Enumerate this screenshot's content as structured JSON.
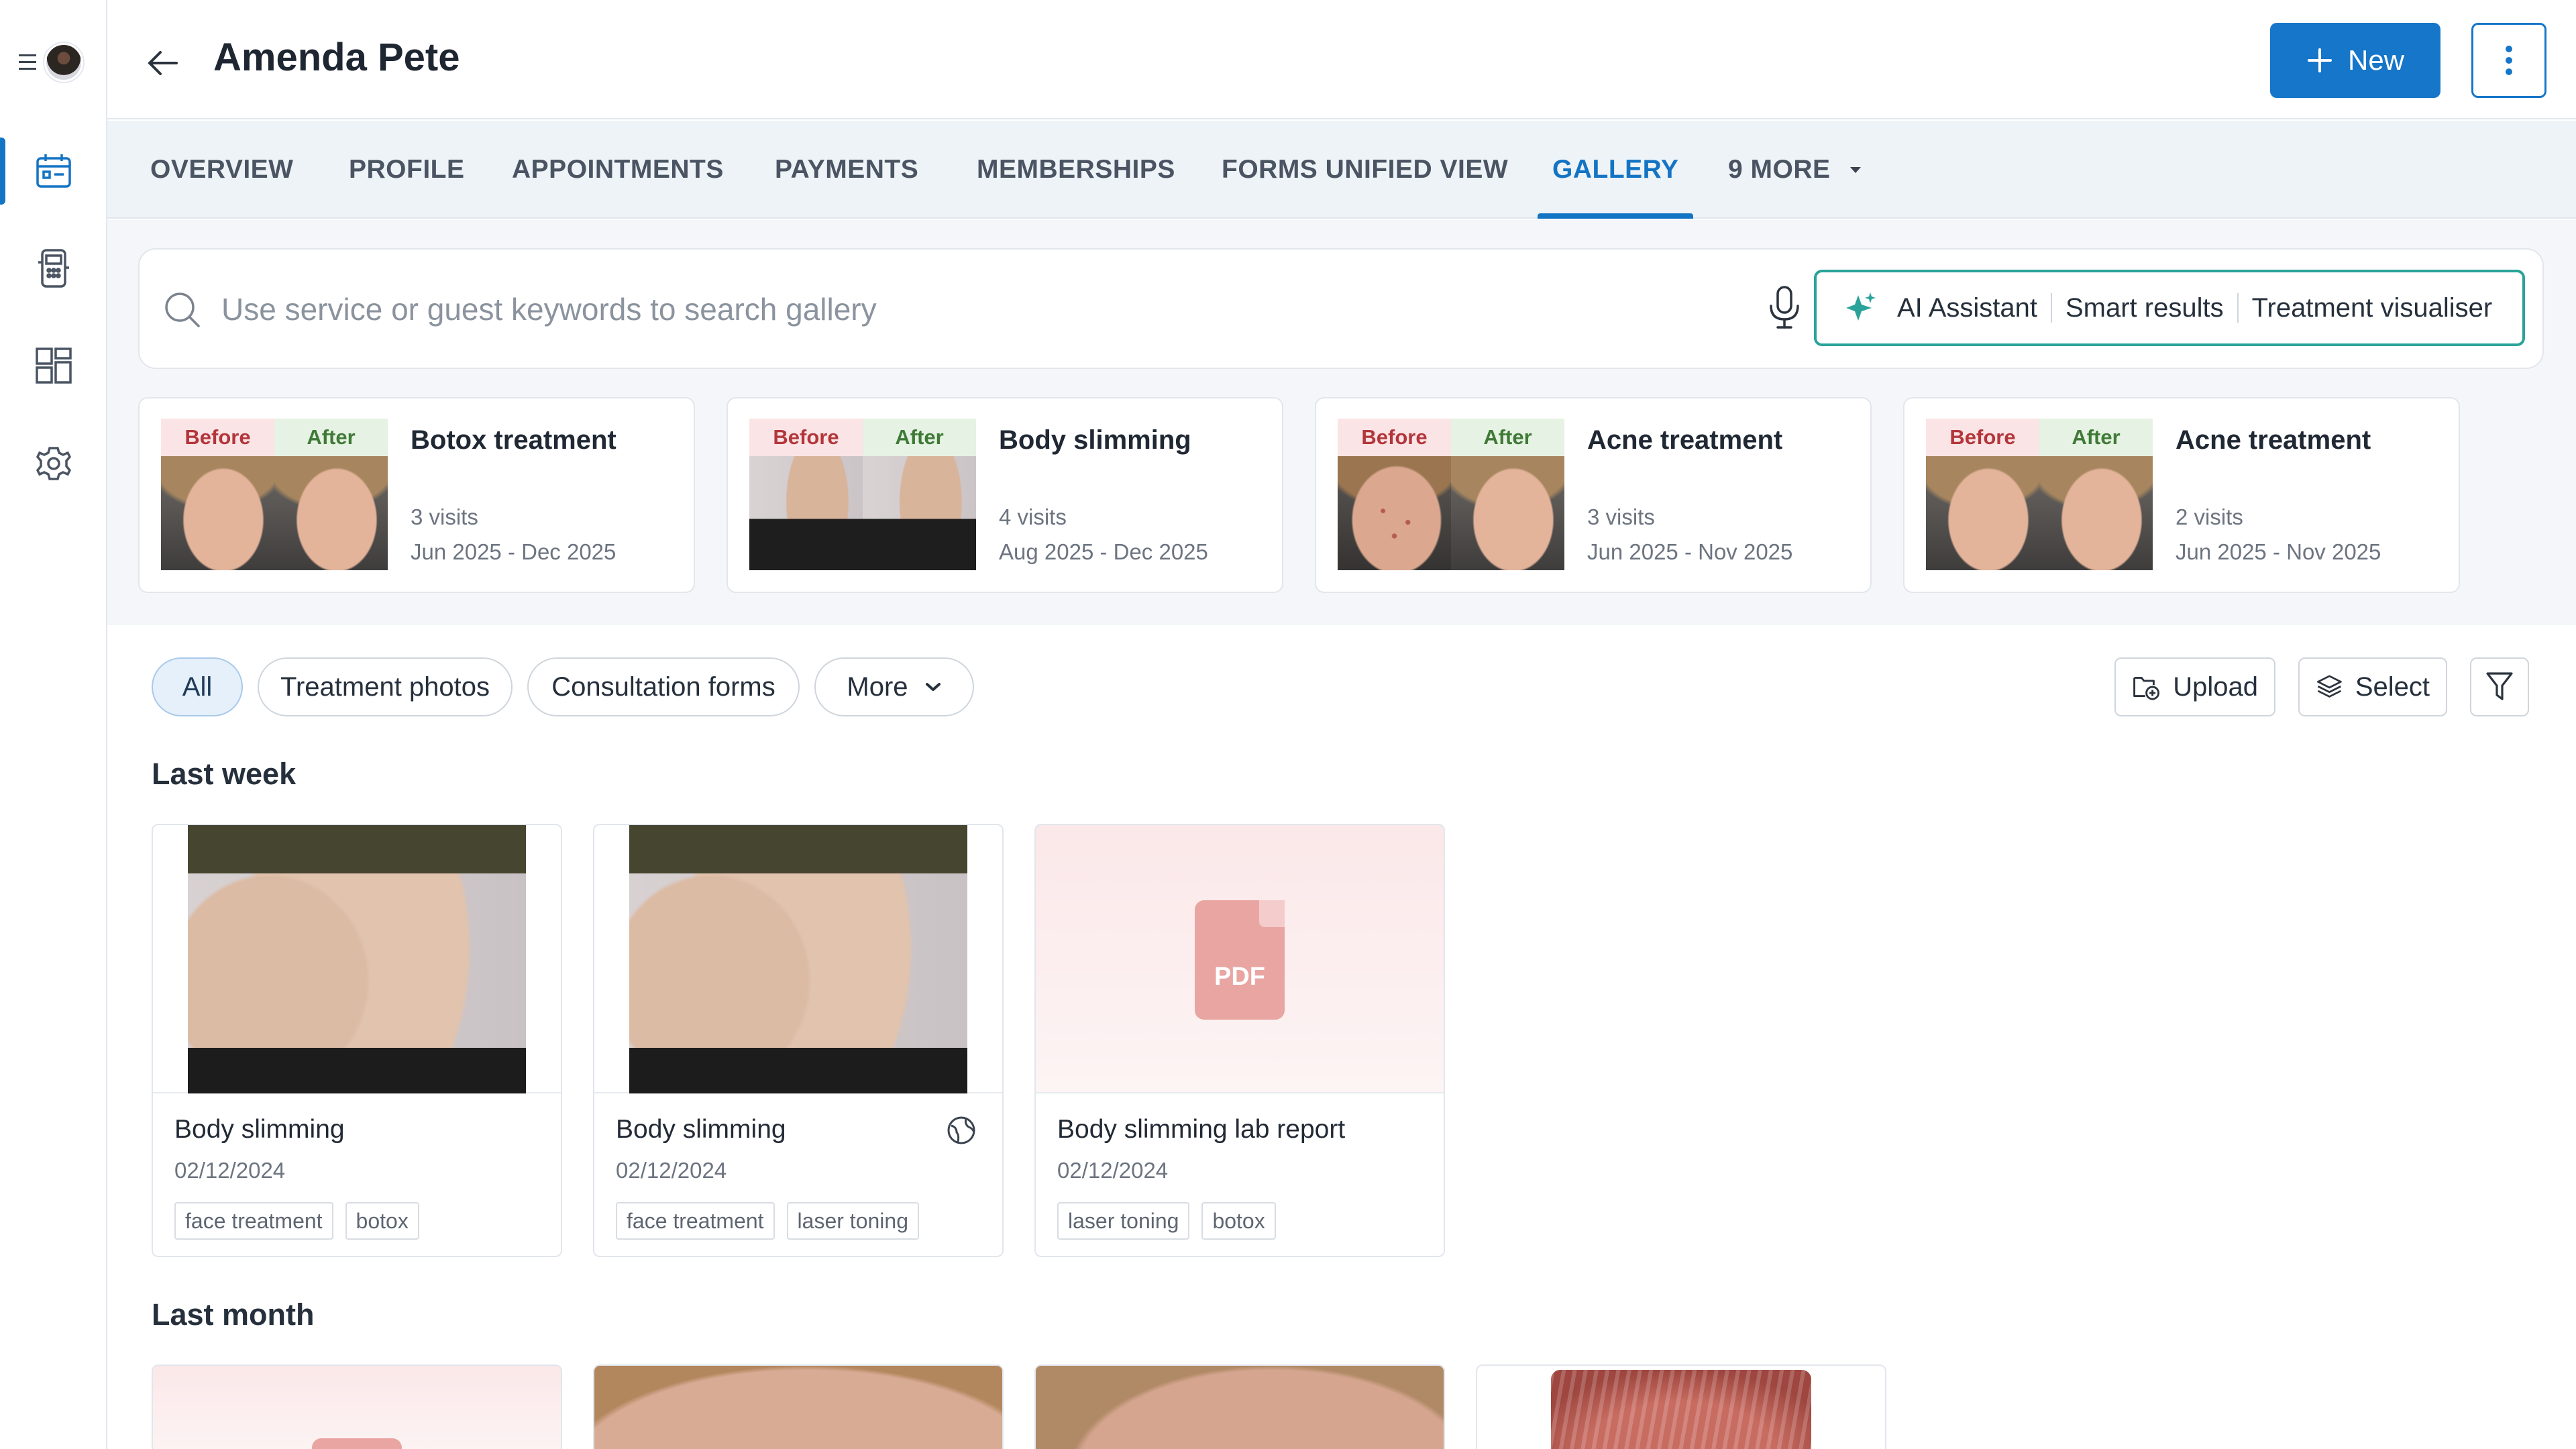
{
  "header": {
    "title": "Amenda Pete",
    "new_label": "New"
  },
  "tabs": [
    {
      "label": "OVERVIEW"
    },
    {
      "label": "PROFILE"
    },
    {
      "label": "APPOINTMENTS"
    },
    {
      "label": "PAYMENTS"
    },
    {
      "label": "MEMBERSHIPS"
    },
    {
      "label": "FORMS UNIFIED VIEW"
    },
    {
      "label": "GALLERY",
      "active": true
    },
    {
      "label": "9 MORE"
    }
  ],
  "search": {
    "placeholder": "Use service or guest keywords to search gallery",
    "ai_assistant": "AI Assistant",
    "smart_results": "Smart results",
    "treatment_visualiser": "Treatment visualiser"
  },
  "before_after": {
    "before_label": "Before",
    "after_label": "After",
    "cards": [
      {
        "title": "Botox treatment",
        "visits": "3 visits",
        "range": "Jun 2025  - Dec 2025"
      },
      {
        "title": "Body slimming",
        "visits": "4 visits",
        "range": "Aug 2025  - Dec 2025"
      },
      {
        "title": "Acne treatment",
        "visits": "3 visits",
        "range": "Jun 2025  - Nov 2025"
      },
      {
        "title": "Acne treatment",
        "visits": "2 visits",
        "range": "Jun 2025  - Nov 2025"
      }
    ]
  },
  "filters": {
    "chips": [
      {
        "label": "All",
        "active": true
      },
      {
        "label": "Treatment photos"
      },
      {
        "label": "Consultation forms"
      },
      {
        "label": "More"
      }
    ],
    "upload_label": "Upload",
    "select_label": "Select"
  },
  "sections": {
    "last_week": "Last week",
    "last_month": "Last month"
  },
  "gallery": [
    {
      "title": "Body slimming",
      "date": "02/12/2024",
      "tags": [
        "face treatment",
        "botox"
      ]
    },
    {
      "title": "Body slimming",
      "date": "02/12/2024",
      "tags": [
        "face treatment",
        "laser toning"
      ]
    },
    {
      "title": "Body slimming lab report",
      "date": "02/12/2024",
      "tags": [
        "laser toning",
        "botox"
      ],
      "pdf_label": "PDF"
    }
  ],
  "colors": {
    "accent": "#1474c4",
    "ai_border": "#2aa39a",
    "before_bg": "#fbe4e5",
    "after_bg": "#e6f2e3",
    "pdf": "#e9a5a2"
  }
}
